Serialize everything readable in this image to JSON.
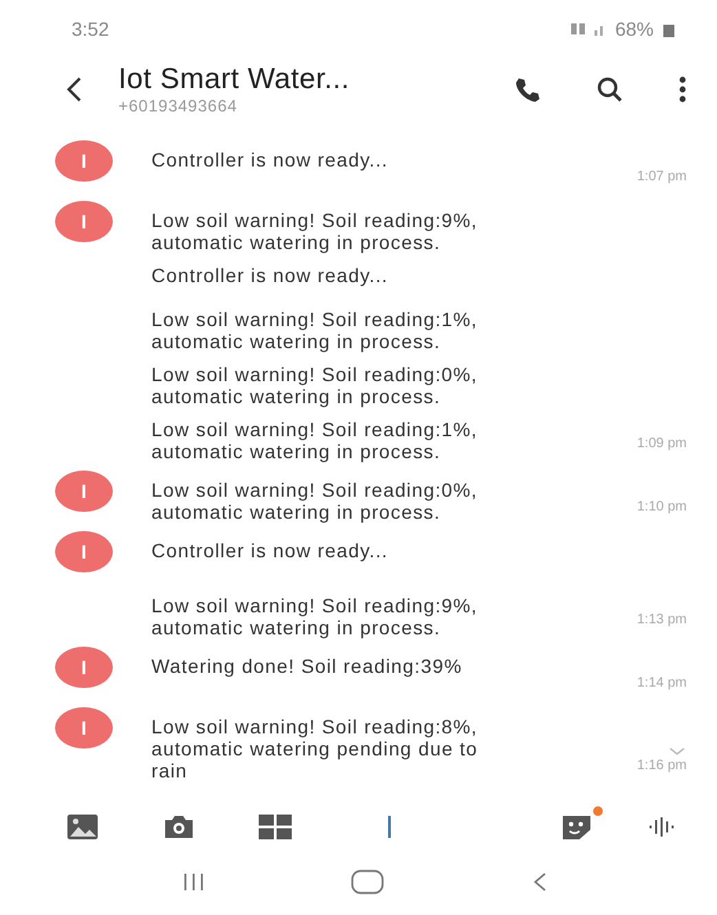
{
  "status_bar": {
    "time": "3:52",
    "battery": "68%"
  },
  "header": {
    "title": "Iot Smart Water...",
    "subtitle": "+60193493664"
  },
  "messages": [
    {
      "avatar": "I",
      "text": "Controller is now ready...",
      "time": "1:07 pm"
    },
    {
      "avatar": "I",
      "text": "Low soil warning! Soil reading:9%, automatic watering in process."
    },
    {
      "text": "Controller is now ready..."
    },
    {
      "text": "Low soil warning! Soil reading:1%, automatic watering in process."
    },
    {
      "text": "Low soil warning! Soil reading:0%, automatic watering in process."
    },
    {
      "text": "Low soil warning! Soil reading:1%, automatic watering in process.",
      "time": "1:09 pm"
    },
    {
      "avatar": "I",
      "text": "Low soil warning! Soil reading:0%, automatic watering in process.",
      "time": "1:10 pm"
    },
    {
      "avatar": "I",
      "text": "Controller is now ready..."
    },
    {
      "text": "Low soil warning! Soil reading:9%, automatic watering in process.",
      "time": "1:13 pm"
    },
    {
      "avatar": "I",
      "text": "Watering done! Soil reading:39%",
      "time": "1:14 pm"
    },
    {
      "avatar": "I",
      "text": "Low soil warning! Soil reading:8%, automatic watering pending due to rain",
      "time": "1:16 pm",
      "expandable": true
    }
  ],
  "composer": {
    "sticker_badge": true
  }
}
